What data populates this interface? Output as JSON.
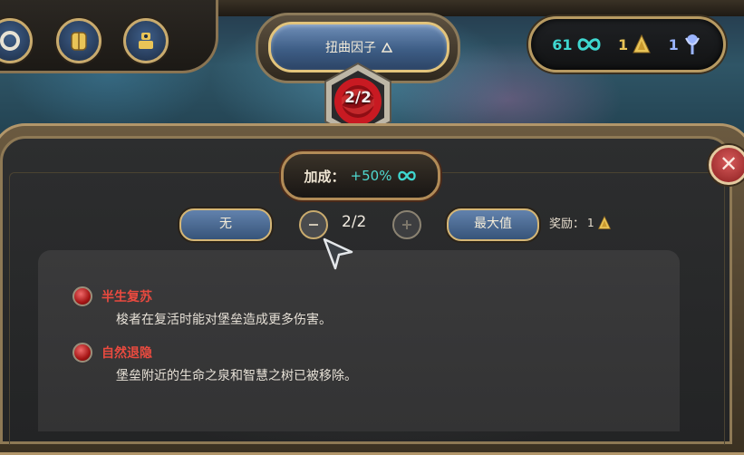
{
  "title": {
    "text": "扭曲因子"
  },
  "badge": {
    "text": "2/2"
  },
  "currencies": [
    {
      "value": "61",
      "icon": "cyan-infinity-icon"
    },
    {
      "value": "1",
      "icon": "gold-pyramid-icon"
    },
    {
      "value": "1",
      "icon": "blue-crystal-icon"
    }
  ],
  "bonus": {
    "label": "加成：",
    "value": "+50%",
    "icon": "cyan-infinity-icon"
  },
  "controls": {
    "none_label": "无",
    "counter": "2/2",
    "max_label": "最大值",
    "reward_label": "奖励：",
    "reward_value": "1"
  },
  "modifiers": [
    {
      "title": "半生复苏",
      "description": "梭者在复活时能对堡垒造成更多伤害。"
    },
    {
      "title": "自然退隐",
      "description": "堡垒附近的生命之泉和智慧之树已被移除。"
    }
  ],
  "colors": {
    "accent_gold": "#e2c47c",
    "cyan": "#3fd7d0",
    "modifier_red": "#ea4a3f",
    "button_blue": "#4a6a94"
  }
}
